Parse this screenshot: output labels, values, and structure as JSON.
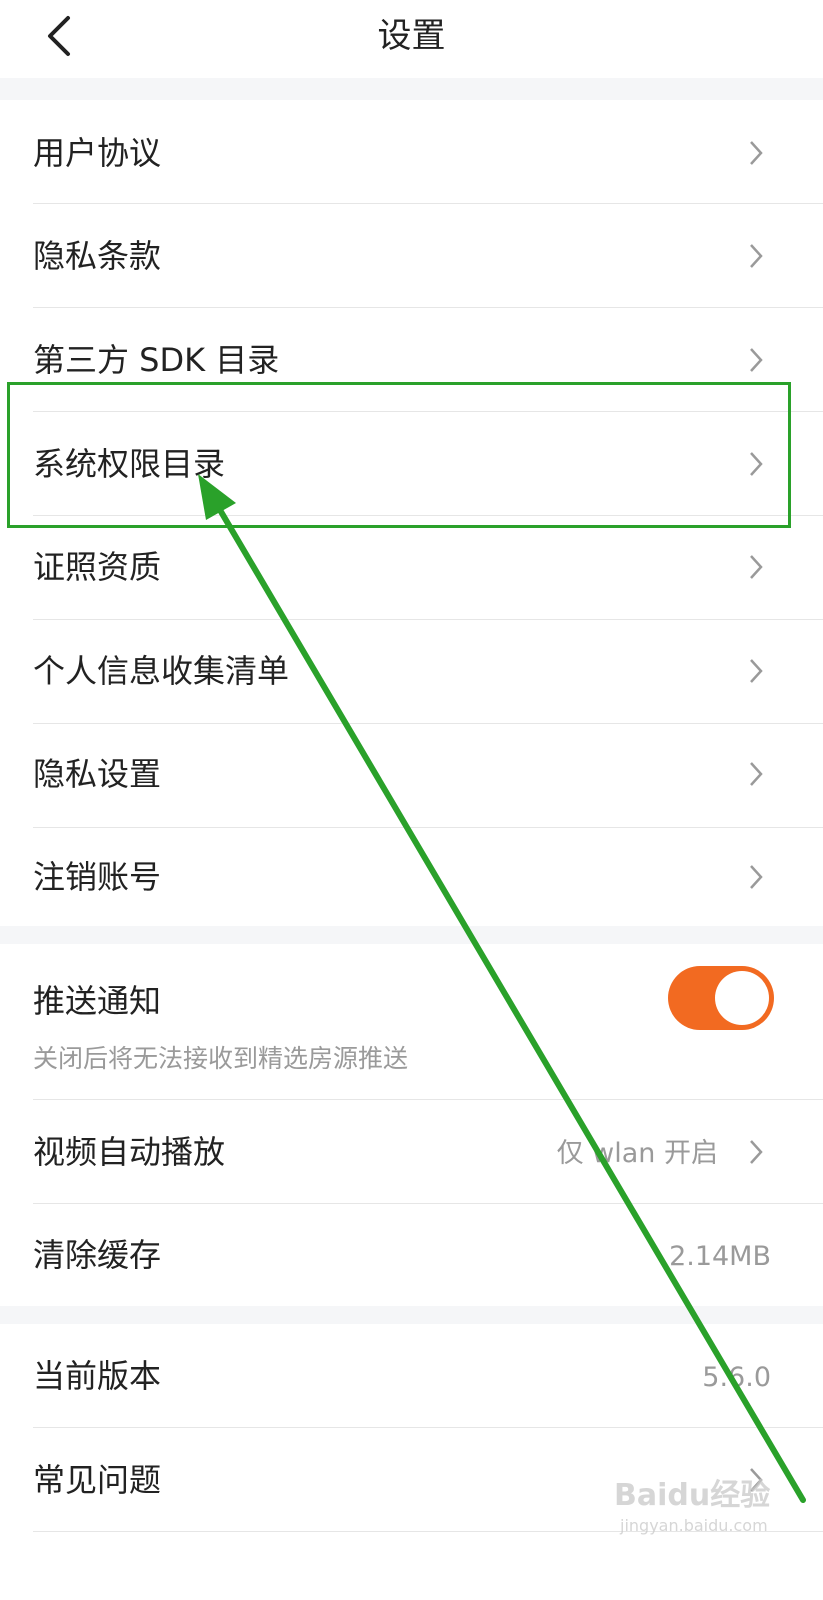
{
  "navbar": {
    "title": "设置"
  },
  "group1": {
    "items": [
      {
        "label": "用户协议"
      },
      {
        "label": "隐私条款"
      },
      {
        "label": "第三方 SDK 目录"
      },
      {
        "label": "系统权限目录"
      },
      {
        "label": "证照资质"
      },
      {
        "label": "个人信息收集清单"
      },
      {
        "label": "隐私设置"
      },
      {
        "label": "注销账号"
      }
    ]
  },
  "group2": {
    "push": {
      "label": "推送通知",
      "sub": "关闭后将无法接收到精选房源推送",
      "enabled": true
    },
    "video": {
      "label": "视频自动播放",
      "value": "仅 wlan 开启"
    },
    "cache": {
      "label": "清除缓存",
      "value": "2.14MB"
    }
  },
  "group3": {
    "version": {
      "label": "当前版本",
      "value": "5.6.0"
    },
    "faq": {
      "label": "常见问题"
    }
  },
  "colors": {
    "accent": "#f26a21",
    "annotation": "#2aa12a"
  },
  "watermark": {
    "brand": "Baidu经验",
    "url": "jingyan.baidu.com"
  }
}
